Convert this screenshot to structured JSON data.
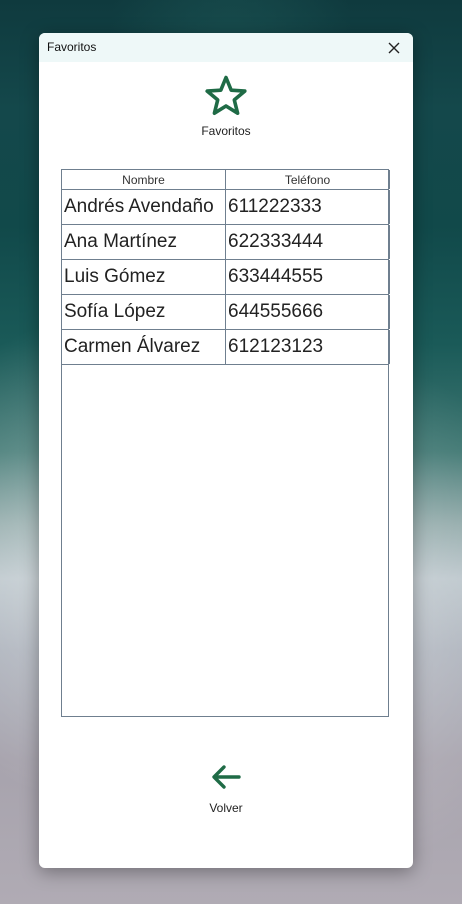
{
  "window": {
    "title": "Favoritos"
  },
  "header": {
    "icon": "star-outline-icon",
    "label": "Favoritos"
  },
  "table": {
    "columns": [
      "Nombre",
      "Teléfono"
    ],
    "rows": [
      [
        "Andrés Avendaño",
        "611222333"
      ],
      [
        "Ana Martínez",
        "622333444"
      ],
      [
        "Luis Gómez",
        "633444555"
      ],
      [
        "Sofía López",
        "644555666"
      ],
      [
        "Carmen Álvarez",
        "612123123"
      ]
    ]
  },
  "footer": {
    "back_icon": "arrow-left-icon",
    "back_label": "Volver"
  },
  "colors": {
    "accent": "#1f6b46",
    "titlebar": "#eef8f8",
    "border": "#6f7f8f"
  }
}
